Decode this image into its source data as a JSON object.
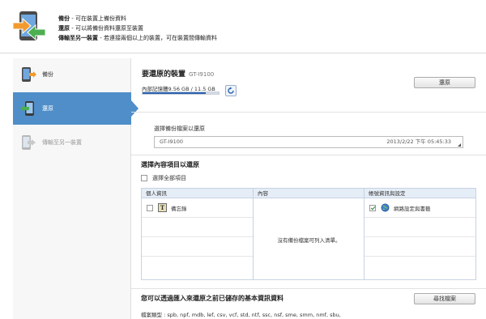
{
  "header": {
    "lines": [
      {
        "term": "備份",
        "desc": " - 可在裝置上備份資料"
      },
      {
        "term": "還原",
        "desc": " - 可以將備份資料還原至裝置"
      },
      {
        "term": "傳輸至另一裝置",
        "desc": " - 若連接兩個以上的裝置，可在裝置間傳輸資料"
      }
    ]
  },
  "nav": {
    "items": [
      {
        "label": "備份",
        "state": "normal"
      },
      {
        "label": "還原",
        "state": "active"
      },
      {
        "label": "傳輸至另一裝置",
        "state": "disabled"
      }
    ]
  },
  "device": {
    "title": "要還原的裝置",
    "model": "GT-I9100",
    "memory_label": "內部記憶體9.56 GB / 11.5 GB",
    "memory_fraction": 0.83,
    "restore_button": "還原"
  },
  "backup_select": {
    "label": "選擇備份檔案以還原",
    "name": "GT-I9100",
    "date": "2013/2/22 下午 05:45:33"
  },
  "items": {
    "title": "選擇內容項目以還原",
    "select_all": "選擇全部項目",
    "columns": [
      "個人資訊",
      "內容",
      "帳號資訊與設定"
    ],
    "personal": [
      {
        "label": "備忘錄",
        "checked": false,
        "icon": "memo-icon"
      }
    ],
    "content_empty": "沒有備份檔案可列入清單。",
    "account": [
      {
        "label": "網路設定與書籤",
        "checked": true,
        "icon": "globe-icon"
      }
    ]
  },
  "bottom": {
    "title": "您可以透過匯入來還原之前已儲存的基本資訊資料",
    "find_button": "尋找檔案",
    "file_types": "檔案類型 : spb, npf, mdb, lef, csv, vcf, std, ntf, ssc, nsf, sme, smm, nmf, sbu,"
  },
  "colors": {
    "accent": "#4f8ec9",
    "memory_fill": "#2b62b0",
    "header_bg": "#e5edf7"
  }
}
